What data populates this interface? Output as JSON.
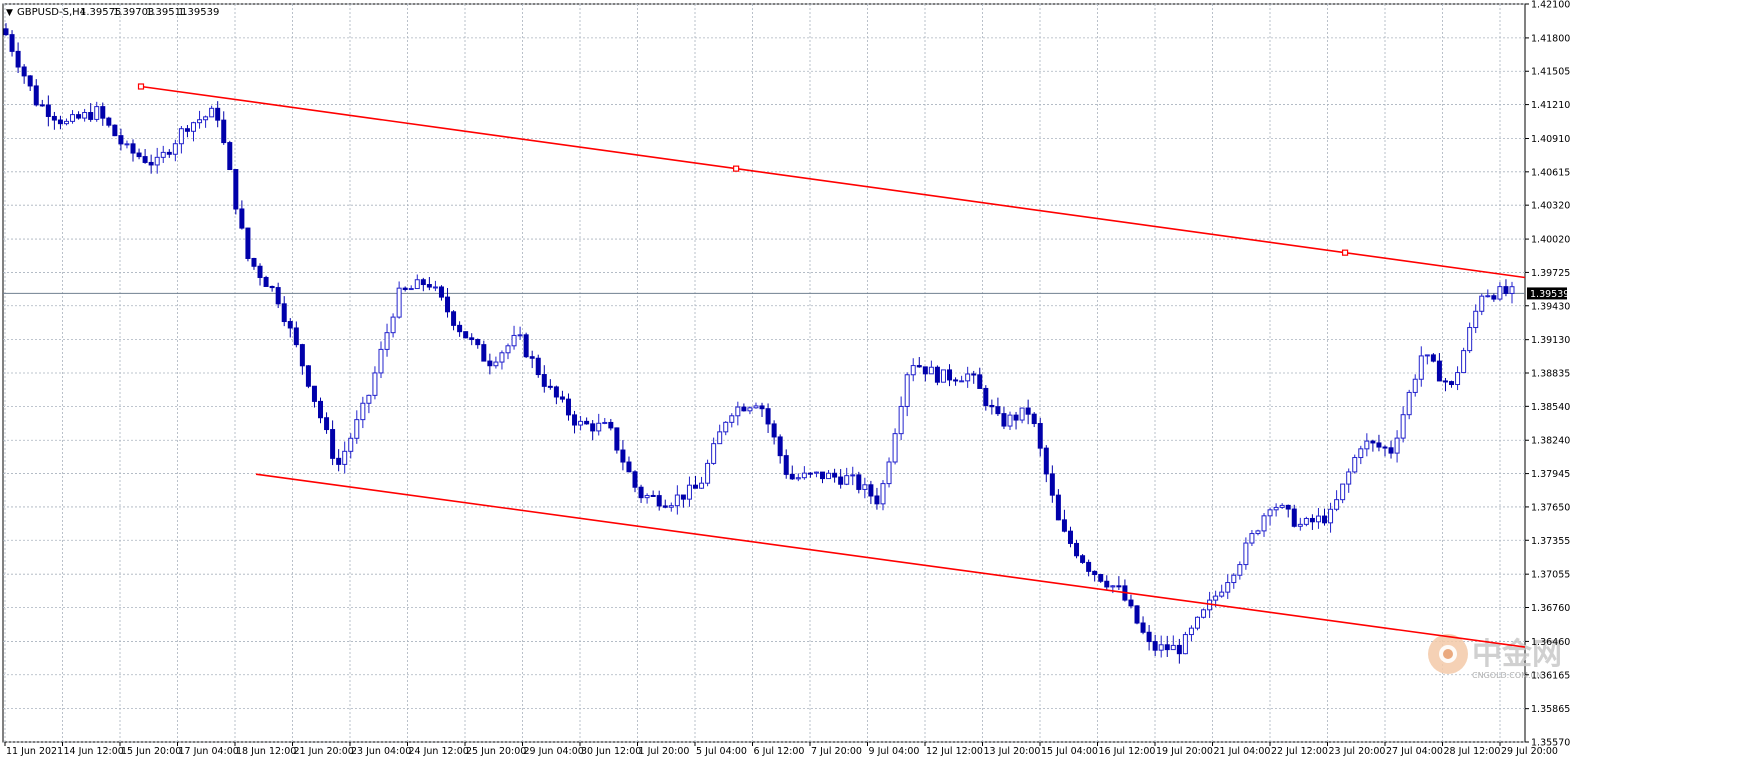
{
  "header": {
    "symbol_label": "GBPUSD-S,H4",
    "open": "1.39575",
    "high": "1.39703",
    "low": "1.39511",
    "close": "1.39539"
  },
  "current_price": "1.39539",
  "price_axis": {
    "min": 1.3557,
    "max": 1.421,
    "labels": [
      "1.42100",
      "1.41800",
      "1.41505",
      "1.41210",
      "1.40910",
      "1.40615",
      "1.40320",
      "1.40020",
      "1.39725",
      "1.39430",
      "1.39130",
      "1.38835",
      "1.38540",
      "1.38240",
      "1.37945",
      "1.37650",
      "1.37355",
      "1.37055",
      "1.36760",
      "1.36460",
      "1.36165",
      "1.35865",
      "1.35570"
    ]
  },
  "time_axis": {
    "labels": [
      "11 Jun 2021",
      "14 Jun 12:00",
      "15 Jun 20:00",
      "17 Jun 04:00",
      "18 Jun 12:00",
      "21 Jun 20:00",
      "23 Jun 04:00",
      "24 Jun 12:00",
      "25 Jun 20:00",
      "29 Jun 04:00",
      "30 Jun 12:00",
      "1 Jul 20:00",
      "5 Jul 04:00",
      "6 Jul 12:00",
      "7 Jul 20:00",
      "9 Jul 04:00",
      "12 Jul 12:00",
      "13 Jul 20:00",
      "15 Jul 04:00",
      "16 Jul 12:00",
      "19 Jul 20:00",
      "21 Jul 04:00",
      "22 Jul 12:00",
      "23 Jul 20:00",
      "27 Jul 04:00",
      "28 Jul 12:00",
      "29 Jul 20:00"
    ]
  },
  "chart_data": {
    "type": "candlestick",
    "symbol": "GBPUSD-S",
    "timeframe": "H4",
    "ylim": [
      1.3557,
      1.421
    ],
    "x": [
      "11 Jun 2021",
      "14 Jun 12:00",
      "15 Jun 20:00",
      "17 Jun 04:00",
      "18 Jun 12:00",
      "21 Jun 20:00",
      "23 Jun 04:00",
      "24 Jun 12:00",
      "25 Jun 20:00",
      "29 Jun 04:00",
      "30 Jun 12:00",
      "1 Jul 20:00",
      "5 Jul 04:00",
      "6 Jul 12:00",
      "7 Jul 20:00",
      "9 Jul 04:00",
      "12 Jul 12:00",
      "13 Jul 20:00",
      "15 Jul 04:00",
      "16 Jul 12:00",
      "19 Jul 20:00",
      "21 Jul 04:00",
      "22 Jul 12:00",
      "23 Jul 20:00",
      "27 Jul 04:00",
      "28 Jul 12:00",
      "29 Jul 20:00"
    ],
    "close_path": [
      1.4183,
      1.4124,
      1.4104,
      1.4115,
      1.4081,
      1.4068,
      1.4103,
      1.4115,
      1.3986,
      1.3952,
      1.388,
      1.38,
      1.386,
      1.3952,
      1.3965,
      1.3925,
      1.3893,
      1.3915,
      1.387,
      1.3838,
      1.3835,
      1.3776,
      1.377,
      1.3782,
      1.385,
      1.386,
      1.379,
      1.3793,
      1.379,
      1.377,
      1.3895,
      1.388,
      1.3882,
      1.3839,
      1.385,
      1.3745,
      1.371,
      1.369,
      1.364,
      1.364,
      1.368,
      1.372,
      1.377,
      1.3748,
      1.3758,
      1.3822,
      1.3815,
      1.39,
      1.387,
      1.3955,
      1.3954
    ],
    "colors": {
      "bull": "#2222cc",
      "bear": "#0000aa",
      "trend_line": "#ff0000",
      "bid_line": "#708090",
      "grid": "#a9b2be"
    }
  },
  "trend_lines": {
    "upper": {
      "t1": "15 Jun 20:00",
      "p1": 1.4137,
      "t2": "29 Jul 20:00",
      "p2": 1.3968
    },
    "lower": {
      "t1": "18 Jun 12:00",
      "p1": 1.3794,
      "t2": "29 Jul 20:00",
      "p2": 1.3641
    }
  },
  "watermark": {
    "brand": "中金网",
    "domain": "CNGOLD.COM.CN"
  }
}
